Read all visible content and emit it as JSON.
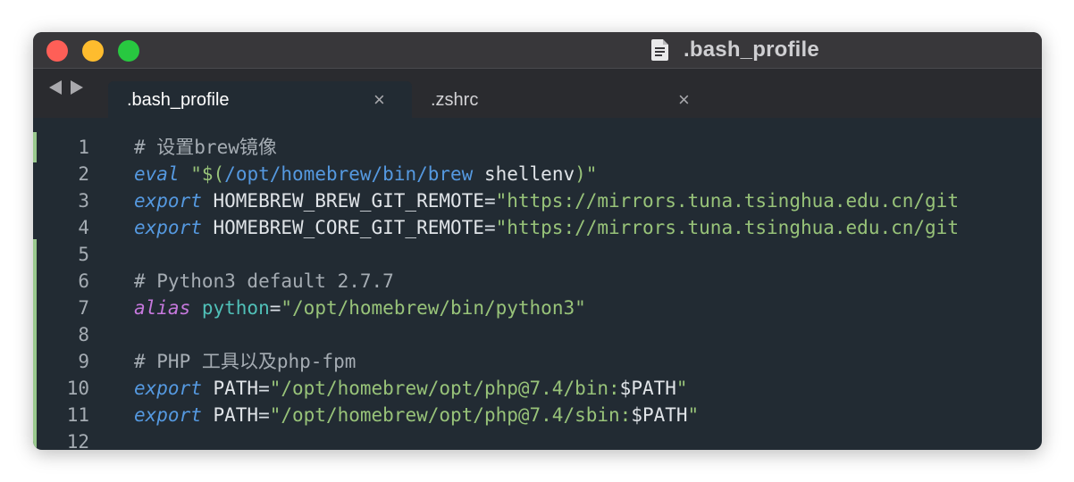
{
  "window": {
    "title": ".bash_profile",
    "icon": "document-icon",
    "colors": {
      "close": "#fe5f57",
      "minimize": "#febc2e",
      "zoom": "#28c840"
    }
  },
  "tabs": [
    {
      "label": ".bash_profile",
      "active": true,
      "close": "×"
    },
    {
      "label": ".zshrc",
      "active": false,
      "close": "×"
    }
  ],
  "editor": {
    "lines": [
      {
        "num": "1",
        "parts": [
          {
            "t": "# 设置brew镜像",
            "c": "cmt"
          }
        ]
      },
      {
        "num": "2",
        "parts": [
          {
            "t": "eval",
            "c": "kw"
          },
          {
            "t": " ",
            "c": "sym"
          },
          {
            "t": "\"$(",
            "c": "str"
          },
          {
            "t": "/opt/homebrew/bin/brew",
            "c": "kw-path"
          },
          {
            "t": " shellenv",
            "c": "var"
          },
          {
            "t": ")\"",
            "c": "str"
          }
        ]
      },
      {
        "num": "3",
        "parts": [
          {
            "t": "export",
            "c": "kw"
          },
          {
            "t": " HOMEBREW_BREW_GIT_REMOTE",
            "c": "var"
          },
          {
            "t": "=",
            "c": "sym"
          },
          {
            "t": "\"https://mirrors.tuna.tsinghua.edu.cn/git",
            "c": "str"
          }
        ]
      },
      {
        "num": "4",
        "parts": [
          {
            "t": "export",
            "c": "kw"
          },
          {
            "t": " HOMEBREW_CORE_GIT_REMOTE",
            "c": "var"
          },
          {
            "t": "=",
            "c": "sym"
          },
          {
            "t": "\"https://mirrors.tuna.tsinghua.edu.cn/git",
            "c": "str"
          }
        ]
      },
      {
        "num": "5",
        "parts": []
      },
      {
        "num": "6",
        "parts": [
          {
            "t": "# Python3 default 2.7.7",
            "c": "cmt"
          }
        ]
      },
      {
        "num": "7",
        "parts": [
          {
            "t": "alias",
            "c": "kw-alias"
          },
          {
            "t": " python",
            "c": "teal"
          },
          {
            "t": "=",
            "c": "sym"
          },
          {
            "t": "\"/opt/homebrew/bin/python3\"",
            "c": "str"
          }
        ]
      },
      {
        "num": "8",
        "parts": []
      },
      {
        "num": "9",
        "parts": [
          {
            "t": "# PHP 工具以及php-fpm",
            "c": "cmt"
          }
        ]
      },
      {
        "num": "10",
        "parts": [
          {
            "t": "export",
            "c": "kw"
          },
          {
            "t": " PATH",
            "c": "var"
          },
          {
            "t": "=",
            "c": "sym"
          },
          {
            "t": "\"/opt/homebrew/opt/php@7.4/bin:",
            "c": "str"
          },
          {
            "t": "$PATH",
            "c": "var"
          },
          {
            "t": "\"",
            "c": "str"
          }
        ]
      },
      {
        "num": "11",
        "parts": [
          {
            "t": "export",
            "c": "kw"
          },
          {
            "t": " PATH",
            "c": "var"
          },
          {
            "t": "=",
            "c": "sym"
          },
          {
            "t": "\"/opt/homebrew/opt/php@7.4/sbin:",
            "c": "str"
          },
          {
            "t": "$PATH",
            "c": "var"
          },
          {
            "t": "\"",
            "c": "str"
          }
        ]
      },
      {
        "num": "12",
        "parts": []
      }
    ]
  }
}
